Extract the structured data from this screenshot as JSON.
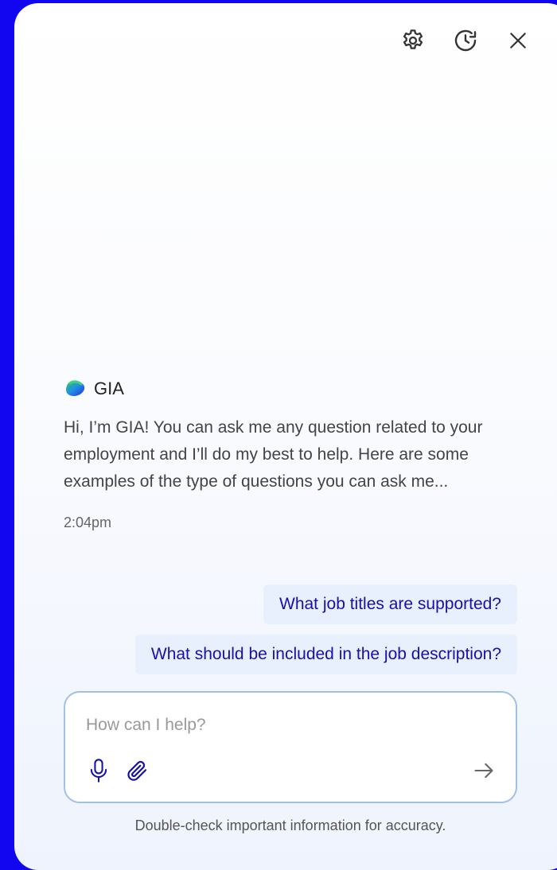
{
  "header": {
    "settings_icon": "gear-icon",
    "history_icon": "clock-history-icon",
    "close_icon": "close-icon"
  },
  "assistant": {
    "name": "GIA",
    "logo_icon": "gia-logo-icon",
    "message": "Hi, I’m GIA! You can ask me any question related to your employment and I’ll do my best to help. Here are some examples of the type of questions you can ask me...",
    "timestamp": "2:04pm"
  },
  "suggestions": [
    "What job titles are supported?",
    "What should be included in the job description?"
  ],
  "composer": {
    "placeholder": "How can I help?",
    "value": "",
    "mic_icon": "microphone-icon",
    "attach_icon": "paperclip-icon",
    "send_icon": "arrow-right-icon"
  },
  "footer": {
    "disclaimer": "Double-check important information for accuracy."
  },
  "colors": {
    "background": "#1206f0",
    "accent_text": "#1711a8",
    "suggestion_bg": "#e8effd",
    "composer_border": "#9fc0e8"
  }
}
